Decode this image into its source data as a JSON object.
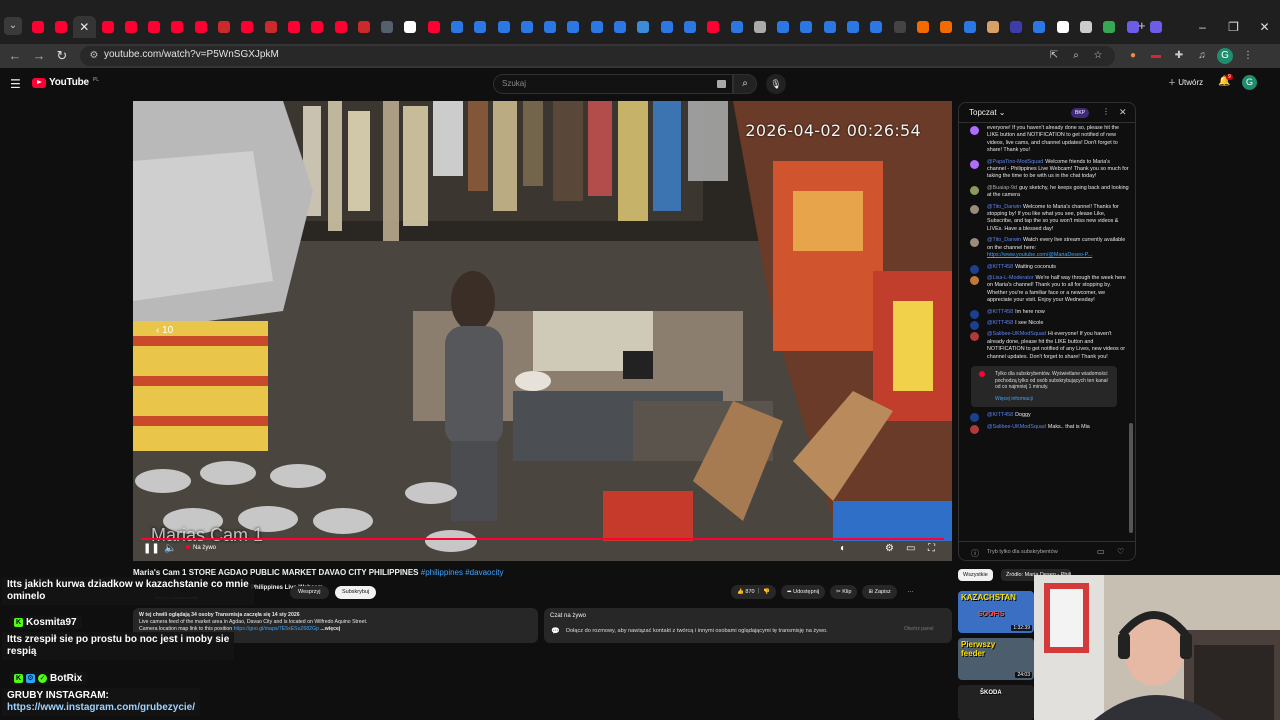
{
  "browser": {
    "tab_colors": [
      "#ff0033",
      "#ff0033",
      "#ff0033",
      "#ff0033",
      "#ff0033",
      "#ff0033",
      "#ff0033",
      "#ff0033",
      "#cc2a2a",
      "#ff0033",
      "#cc2a2a",
      "#ff0033",
      "#ff0033",
      "#ff0033",
      "#cc2a2a",
      "#55606e",
      "#ffffff",
      "#ff0033",
      "#2b78e4",
      "#2b78e4",
      "#2b78e4",
      "#2b78e4",
      "#2b78e4",
      "#2b78e4",
      "#2b78e4",
      "#2b78e4",
      "#3b8bd9",
      "#2b78e4",
      "#2b78e4",
      "#ff0033",
      "#2b78e4",
      "#aaaaaa",
      "#2b78e4",
      "#2b78e4",
      "#2b78e4",
      "#2b78e4",
      "#2b78e4",
      "#444444",
      "#f56a00",
      "#f56a00",
      "#2b78e4",
      "#d9a066",
      "#3c3caa",
      "#2b78e4",
      "#ffffff",
      "#cccccc",
      "#34a853",
      "#6c5ce7",
      "#6c5ce7"
    ],
    "active_tab_index": 2,
    "active_tab_icon": "close-icon",
    "new_tab_icon": "plus-icon",
    "window_controls": [
      "minimize-icon",
      "restore-icon",
      "close-icon"
    ],
    "url": "youtube.com/watch?v=P5WnSGXJpkM",
    "profile_letter": "G"
  },
  "youtube": {
    "logo_text": "YouTube",
    "logo_country": "PL",
    "search_placeholder": "Szukaj",
    "create_label": "Utwórz",
    "notif_count": "9",
    "user_letter": "G"
  },
  "video": {
    "timestamp_overlay": "2026-04-02 00:26:54",
    "cam_title_overlay": "Marias Cam 1",
    "seek_label": "10",
    "live_label": "Na żywo",
    "progress_fraction": 1.0
  },
  "chat": {
    "header_title": "Topczat",
    "header_pill": "BKP",
    "messages": [
      {
        "author": "",
        "text": "everyone! If you haven't already done so, please hit the LIKE button and NOTIFICATION to get notified of new videos, live cams, and channel updates! Don't forget to share! Thank you!",
        "avatar_color": "#b06cff"
      },
      {
        "author": "@PapaTino-ModSquad",
        "text": "Welcome friends to Maria's channel - Philippines Live Webcam! Thank you so much for taking the time to be with us in the chat today!",
        "avatar_color": "#b06cff"
      },
      {
        "author": "@Buaiap-9d",
        "text": "guy sketchy, he keeps going back and looking at the camera",
        "avatar_color": "#8a9a5b",
        "plain": true
      },
      {
        "author": "@Tito_Darwin",
        "text": "Welcome to Maria's channel! Thanks for stopping by! If you like what you see, please Like, Subscribe, and tap the so you won't miss new videos & LIVEs. Have a blessed day!",
        "avatar_color": "#9c8a7a"
      },
      {
        "author": "@Tito_Darwin",
        "text": "Watch every live stream currently available on the channel here:",
        "link": "https://www.youtube.com/@MariaDeseo-P...",
        "avatar_color": "#9c8a7a"
      },
      {
        "author": "@KITT458",
        "text": "Waiting coconuts",
        "avatar_color": "#1c3f8f"
      },
      {
        "author": "@Lisa-L-Moderator",
        "text": "We're half way through the week here on Maria's channel! Thank you to all for stopping by. Whether you're a familiar face or a newcomer, we appreciate your visit. Enjoy your Wednesday!",
        "avatar_color": "#c0783a"
      },
      {
        "author": "@KITT458",
        "text": "Im here now",
        "avatar_color": "#1c3f8f"
      },
      {
        "author": "@KITT458",
        "text": "I see Nicole",
        "avatar_color": "#1c3f8f"
      },
      {
        "author": "@Salibee-UKModSquad",
        "text": "Hi everyone! If you haven't already done, please hit the LIKE button and NOTIFICATION to get notified of any Lives, new videos or channel updates. Don't forget to share! Thank you!",
        "avatar_color": "#b03a3a"
      }
    ],
    "members_notice": "Tylko dla subskrybentów. Wyświetlane wiadomości pochodzą tylko od osób subskrybujących ten kanał od co najmniej 1 minuty.",
    "members_more": "Więcej informacji",
    "messages_after": [
      {
        "author": "@KITT458",
        "text": "Doggy",
        "avatar_color": "#1c3f8f"
      },
      {
        "author": "@Salibee-UKModSquad",
        "text": "Maks.. that is Mia",
        "avatar_color": "#b03a3a"
      }
    ],
    "footer_text": "Tryb tylko dla subskrybentów"
  },
  "details": {
    "title_main": "Maria's Cam 1 STORE AGDAO PUBLIC MARKET DAVAO CITY PHILIPPINES",
    "title_tags": "#philippines #davaocity",
    "channel_name": "Philippines Live Webcam",
    "channel_subs": "29,4 tys. subskrybentów",
    "join_label": "Wesprzyj",
    "subscribe_label": "Subskrybuj",
    "like_count": "870",
    "share_label": "Udostępnij",
    "clip_label": "Klip",
    "save_label": "Zapisz",
    "desc_line1": "W tej chwili oglądają 34 osoby  Transmisja zaczęła się 14 sty 2026",
    "desc_line2": "Live camera feed of the market area in Agdao, Davao City and is located on Wilfredo Aquino Street.",
    "desc_line3_prefix": "Camera location map link to this position",
    "desc_link": "https://goo.gl/maps/7E5xESxZ682Gp",
    "desc_more": "...więcej",
    "livechat_title": "Czat na żywo",
    "livechat_desc": "Dołącz do rozmowy, aby nawiązać kontakt z twórcą i innymi osobami oglądającymi tę transmisję na żywo.",
    "livechat_button": "Otwórz panel"
  },
  "recommendations": {
    "chip_all": "Wszystkie",
    "chip_source": "Źródło: Maria Deseo - Philippines Live",
    "items": [
      {
        "label": "KAZACHSTAN",
        "sub": "SOOFIS",
        "duration": "1:32:39",
        "color": "#3b6fc4"
      },
      {
        "label": "Pierwszy feeder",
        "duration": "24:03",
        "color": "#4c5d6e"
      },
      {
        "label": "ŠKODA",
        "duration": "",
        "color": "#222222"
      }
    ]
  },
  "overlay": {
    "msg1_line1": "Itts jakich kurwa dziadkow w kazachstanie co mnie",
    "msg1_line2": "ominelo",
    "user1": "Kosmita97",
    "msg2_line1": "Itts zrespił sie po prostu bo noc jest i moby sie",
    "msg2_line2": "respią",
    "user2": "BotRix",
    "msg3_line1": "GRUBY INSTAGRAM:",
    "msg3_link": "https://www.instagram.com/grubezycie/"
  }
}
